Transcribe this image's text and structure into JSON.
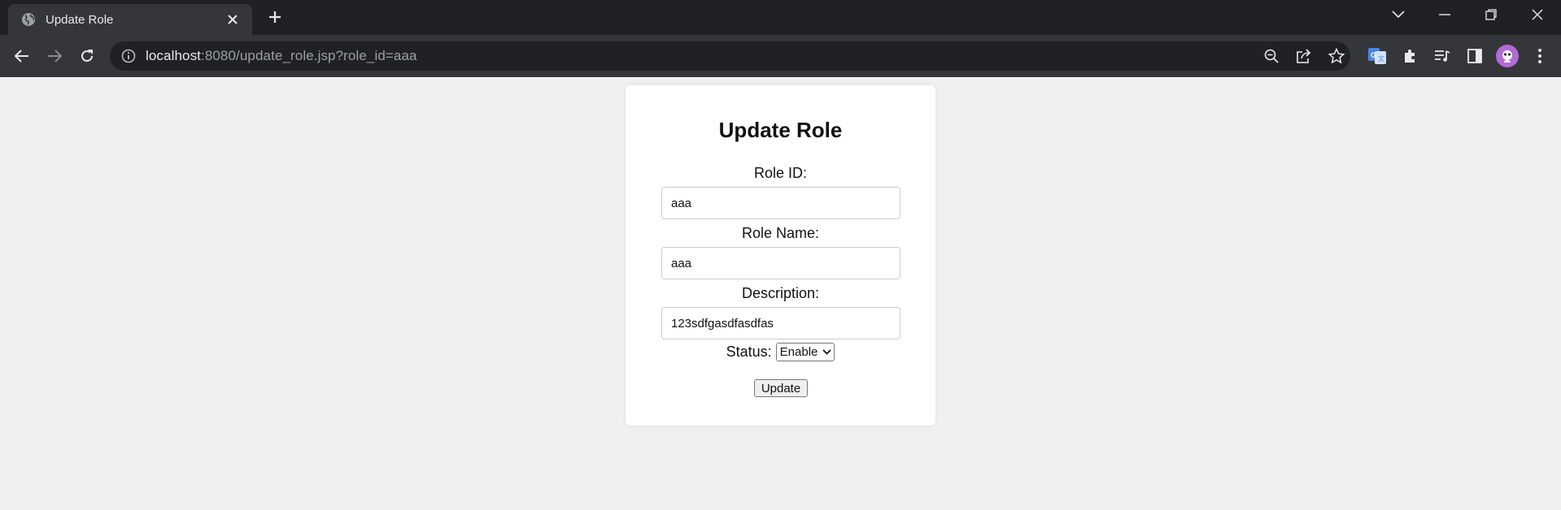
{
  "browser": {
    "tab_title": "Update Role",
    "url_host": "localhost",
    "url_rest": ":8080/update_role.jsp?role_id=aaa"
  },
  "page": {
    "heading": "Update Role",
    "role_id_label": "Role ID:",
    "role_id_value": "aaa",
    "role_name_label": "Role Name:",
    "role_name_value": "aaa",
    "description_label": "Description:",
    "description_value": "123sdfgasdfasdfas",
    "status_label": "Status:",
    "status_selected": "Enable",
    "submit_label": "Update"
  },
  "colors": {
    "page_bg": "#f0f0f0",
    "chrome_dark": "#202124",
    "chrome_toolbar": "#35363a",
    "avatar": "#b26ad8"
  },
  "icons": [
    "globe-icon",
    "close-icon",
    "plus-icon",
    "chevron-down-icon",
    "minimize-icon",
    "restore-icon",
    "back-icon",
    "forward-icon",
    "reload-icon",
    "info-icon",
    "zoom-out-icon",
    "share-icon",
    "star-icon",
    "translate-icon",
    "extensions-icon",
    "media-icon",
    "side-panel-icon",
    "avatar",
    "more-icon"
  ]
}
